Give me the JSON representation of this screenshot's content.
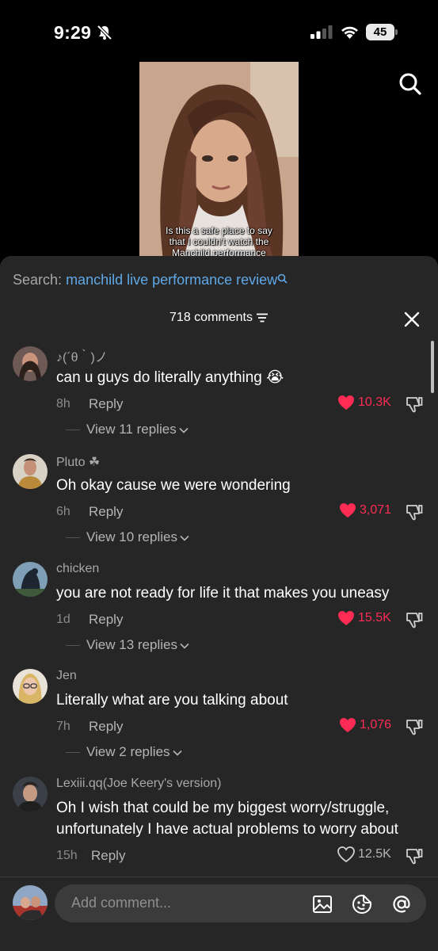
{
  "status_bar": {
    "time": "9:29",
    "battery": "45"
  },
  "video": {
    "caption_lines": [
      "Is this a safe place to say",
      "that I couldn't watch the",
      "Manchild performance"
    ]
  },
  "comments_header": {
    "search_label": "Search:",
    "search_query": "manchild live performance review",
    "count": "718 comments"
  },
  "comments": [
    {
      "username": "♪(´θ｀)ノ",
      "text": "can u guys do literally anything 😭",
      "time": "8h",
      "reply": "Reply",
      "likes": "10.3K",
      "liked": true,
      "view_replies": "View 11 replies"
    },
    {
      "username": "Pluto ☘",
      "text": "Oh okay cause we were wondering",
      "time": "6h",
      "reply": "Reply",
      "likes": "3,071",
      "liked": true,
      "view_replies": "View 10 replies"
    },
    {
      "username": "chicken",
      "text": "you are not ready for life it that makes you uneasy",
      "time": "1d",
      "reply": "Reply",
      "likes": "15.5K",
      "liked": true,
      "view_replies": "View 13 replies"
    },
    {
      "username": "Jen",
      "text": "Literally what are you talking about",
      "time": "7h",
      "reply": "Reply",
      "likes": "1,076",
      "liked": true,
      "view_replies": "View 2 replies"
    },
    {
      "username": "Lexiii.qq(Joe Keery's version)",
      "text": "Oh I wish that could be my biggest worry/struggle, unfortunately I have actual problems to worry about",
      "time": "15h",
      "reply": "Reply",
      "likes": "12.5K",
      "liked": false
    }
  ],
  "composer": {
    "placeholder": "Add comment..."
  },
  "colors": {
    "like_red": "#fe2c55",
    "link_blue": "#5fa8e8",
    "sheet_bg": "#262626"
  },
  "icons": [
    "bell-slash-icon",
    "signal-icon",
    "wifi-icon",
    "battery-icon",
    "search-icon",
    "filter-icon",
    "close-icon",
    "heart-icon",
    "dislike-icon",
    "chevron-down-icon",
    "image-icon",
    "emoji-icon",
    "at-icon"
  ]
}
